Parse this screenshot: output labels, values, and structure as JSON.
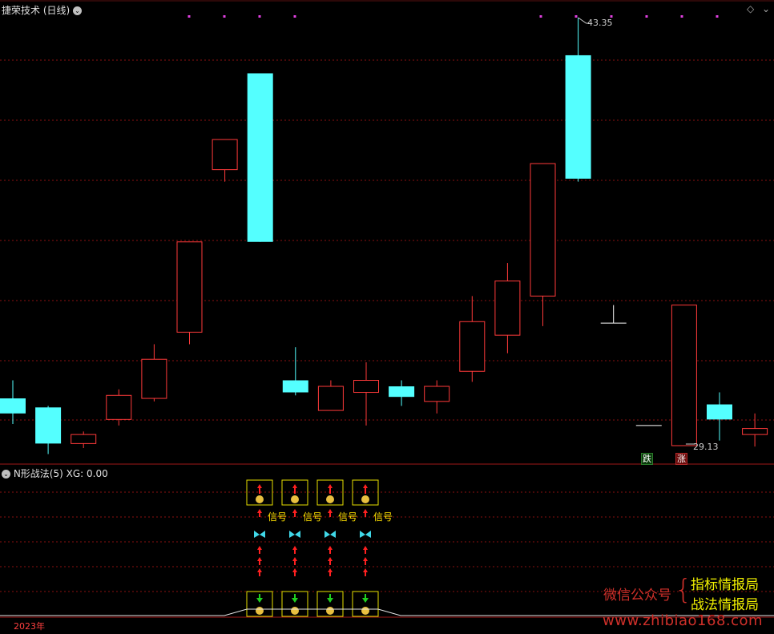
{
  "main_chart": {
    "title": "捷荣技术 (日线)",
    "high_label": "43.35",
    "low_label": "29.13",
    "die_badge": "跌",
    "zhang_badge": "涨",
    "colors": {
      "up": "#ff3a3a",
      "down": "#54ffff",
      "grid": "#8a1010",
      "flat": "#ffffff",
      "dot": "#e040e0"
    }
  },
  "indicator_panel": {
    "title": "N形战法(5) XG: 0.00",
    "signal_label": "信号",
    "signal_count": 4
  },
  "footer": {
    "year_label": "2023年"
  },
  "watermark": {
    "left": "微信公众号",
    "brace": "{",
    "line1": "指标情报局",
    "line2": "战法情报局",
    "url": "www.zhibiao168.com"
  },
  "chart_data": {
    "type": "candlestick",
    "title": "捷荣技术 (日线)",
    "high_marker": 43.35,
    "low_marker": 29.13,
    "candles": [
      {
        "open": 30.7,
        "close": 30.2,
        "high": 31.3,
        "low": 29.85,
        "dir": "down"
      },
      {
        "open": 30.4,
        "close": 29.2,
        "high": 30.45,
        "low": 28.85,
        "dir": "down"
      },
      {
        "open": 29.2,
        "close": 29.5,
        "high": 29.6,
        "low": 29.05,
        "dir": "up"
      },
      {
        "open": 30.0,
        "close": 30.8,
        "high": 31.0,
        "low": 29.8,
        "dir": "up"
      },
      {
        "open": 30.7,
        "close": 32.0,
        "high": 32.5,
        "low": 30.6,
        "dir": "up"
      },
      {
        "open": 32.9,
        "close": 35.9,
        "high": 35.9,
        "low": 32.5,
        "dir": "up"
      },
      {
        "open": 38.3,
        "close": 39.3,
        "high": 39.3,
        "low": 37.9,
        "dir": "up"
      },
      {
        "open": 41.5,
        "close": 35.9,
        "high": 41.5,
        "low": 35.9,
        "dir": "down"
      },
      {
        "open": 31.3,
        "close": 30.9,
        "high": 32.4,
        "low": 30.8,
        "dir": "down"
      },
      {
        "open": 30.3,
        "close": 31.1,
        "high": 31.3,
        "low": 30.3,
        "dir": "up"
      },
      {
        "open": 30.9,
        "close": 31.3,
        "high": 31.9,
        "low": 29.8,
        "dir": "up"
      },
      {
        "open": 31.1,
        "close": 30.75,
        "high": 31.3,
        "low": 30.45,
        "dir": "down"
      },
      {
        "open": 30.6,
        "close": 31.1,
        "high": 31.3,
        "low": 30.2,
        "dir": "up"
      },
      {
        "open": 31.6,
        "close": 33.25,
        "high": 34.1,
        "low": 31.25,
        "dir": "up"
      },
      {
        "open": 32.8,
        "close": 34.6,
        "high": 35.2,
        "low": 32.2,
        "dir": "up"
      },
      {
        "open": 34.1,
        "close": 38.5,
        "high": 38.5,
        "low": 33.1,
        "dir": "up"
      },
      {
        "open": 42.1,
        "close": 38.0,
        "high": 43.35,
        "low": 37.9,
        "dir": "down"
      },
      {
        "open": 33.2,
        "close": 33.2,
        "high": 33.8,
        "low": 33.2,
        "dir": "flat"
      },
      {
        "open": 29.8,
        "close": 29.8,
        "high": 29.8,
        "low": 29.8,
        "dir": "flat"
      },
      {
        "open": 29.13,
        "close": 33.8,
        "high": 33.8,
        "low": 29.13,
        "dir": "up"
      },
      {
        "open": 30.5,
        "close": 30.0,
        "high": 30.9,
        "low": 29.3,
        "dir": "down"
      },
      {
        "open": 29.5,
        "close": 29.7,
        "high": 30.2,
        "low": 29.1,
        "dir": "up"
      }
    ]
  }
}
